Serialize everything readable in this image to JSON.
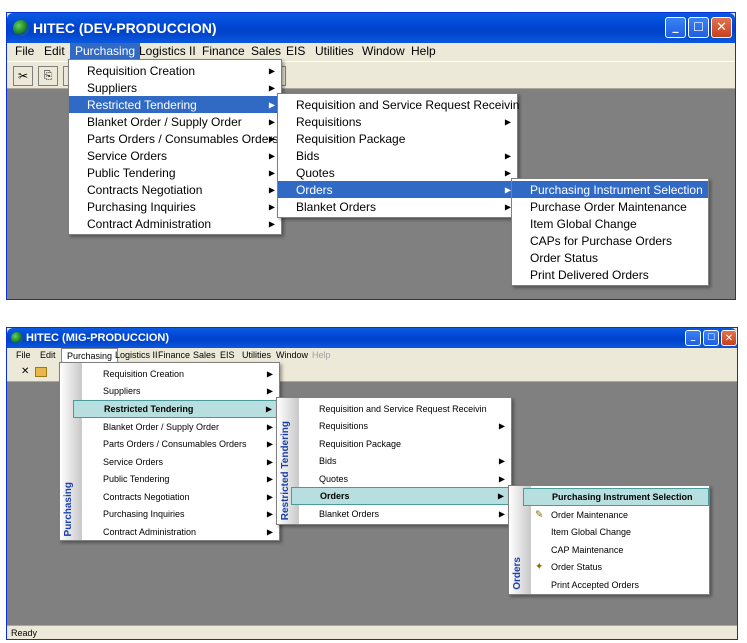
{
  "window1": {
    "title": "HITEC  (DEV-PRODUCCION)",
    "menubar": [
      "File",
      "Edit",
      "Purchasing",
      "Logistics II",
      "Finance",
      "Sales",
      "EIS",
      "Utilities",
      "Window",
      "Help"
    ],
    "purchasing_menu": [
      {
        "label": "Requisition Creation",
        "arrow": true
      },
      {
        "label": "Suppliers",
        "arrow": true
      },
      {
        "label": "Restricted Tendering",
        "arrow": true,
        "selected": true
      },
      {
        "label": "Blanket Order / Supply Order",
        "arrow": true
      },
      {
        "label": "Parts Orders / Consumables Orders",
        "arrow": true
      },
      {
        "label": "Service Orders",
        "arrow": true
      },
      {
        "label": "Public Tendering",
        "arrow": true
      },
      {
        "label": "Contracts Negotiation",
        "arrow": true
      },
      {
        "label": "Purchasing Inquiries",
        "arrow": true
      },
      {
        "label": "Contract Administration",
        "arrow": true
      }
    ],
    "restricted_menu": [
      {
        "label": "Requisition and Service Request Receivin",
        "arrow": false
      },
      {
        "label": "Requisitions",
        "arrow": true
      },
      {
        "label": "Requisition Package",
        "arrow": false
      },
      {
        "label": "Bids",
        "arrow": true
      },
      {
        "label": "Quotes",
        "arrow": true
      },
      {
        "label": "Orders",
        "arrow": true,
        "selected": true
      },
      {
        "label": "Blanket Orders",
        "arrow": true
      }
    ],
    "orders_menu": [
      {
        "label": "Purchasing Instrument Selection",
        "selected": true
      },
      {
        "label": "Purchase Order Maintenance"
      },
      {
        "label": "Item Global Change"
      },
      {
        "label": "CAPs for Purchase Orders"
      },
      {
        "label": "Order Status"
      },
      {
        "label": "Print Delivered Orders"
      }
    ]
  },
  "window2": {
    "title": "HITEC  (MIG-PRODUCCION)",
    "menubar": [
      "File",
      "Edit",
      "Purchasing",
      "Logistics II",
      "Finance",
      "Sales",
      "EIS",
      "Utilities",
      "Window",
      "Help"
    ],
    "sidebar_purchasing": "Purchasing",
    "sidebar_restricted": "Restricted Tendering",
    "sidebar_orders": "Orders",
    "purchasing_menu": [
      {
        "label": "Requisition Creation",
        "arrow": true
      },
      {
        "label": "Suppliers",
        "arrow": true
      },
      {
        "label": "Restricted Tendering",
        "arrow": true,
        "selected": true
      },
      {
        "label": "Blanket Order / Supply Order",
        "arrow": true
      },
      {
        "label": "Parts Orders / Consumables Orders",
        "arrow": true
      },
      {
        "label": "Service Orders",
        "arrow": true
      },
      {
        "label": "Public Tendering",
        "arrow": true
      },
      {
        "label": "Contracts Negotiation",
        "arrow": true
      },
      {
        "label": "Purchasing Inquiries",
        "arrow": true
      },
      {
        "label": "Contract Administration",
        "arrow": true
      }
    ],
    "restricted_menu": [
      {
        "label": "Requisition and Service Request Receivin",
        "arrow": false
      },
      {
        "label": "Requisitions",
        "arrow": true
      },
      {
        "label": "Requisition Package",
        "arrow": false
      },
      {
        "label": "Bids",
        "arrow": true
      },
      {
        "label": "Quotes",
        "arrow": true
      },
      {
        "label": "Orders",
        "arrow": true,
        "selected": true
      },
      {
        "label": "Blanket Orders",
        "arrow": true
      }
    ],
    "orders_menu": [
      {
        "label": "Purchasing Instrument Selection",
        "selected": true
      },
      {
        "label": "Order Maintenance",
        "icon": "edit-icon"
      },
      {
        "label": "Item Global Change"
      },
      {
        "label": "CAP Maintenance"
      },
      {
        "label": "Order Status",
        "icon": "status-icon"
      },
      {
        "label": "Print Accepted Orders"
      }
    ],
    "status": "Ready"
  }
}
